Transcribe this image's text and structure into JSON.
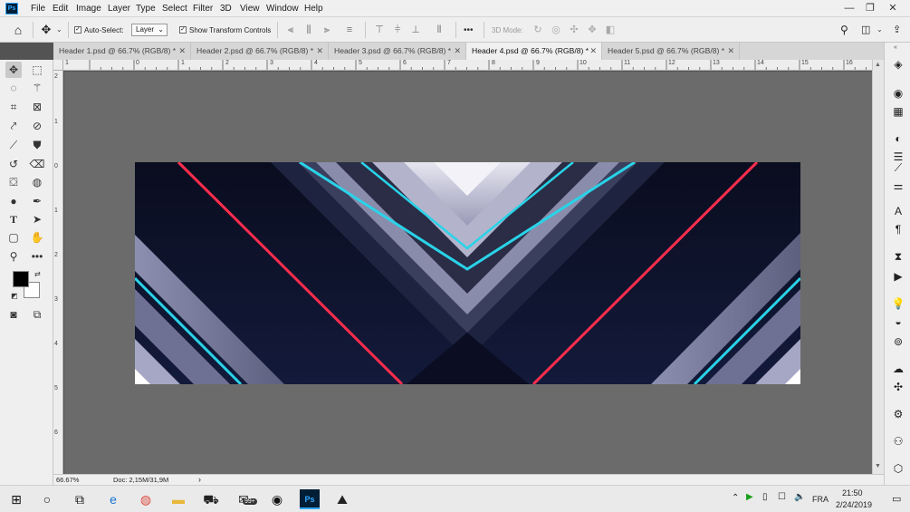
{
  "app": {
    "logo": "Ps"
  },
  "menu": [
    "File",
    "Edit",
    "Image",
    "Layer",
    "Type",
    "Select",
    "Filter",
    "3D",
    "View",
    "Window",
    "Help"
  ],
  "window_controls": {
    "minimize": "—",
    "restore": "❐",
    "close": "✕"
  },
  "options": {
    "auto_select_label": "Auto-Select:",
    "auto_select_checked": true,
    "auto_select_target": "Layer",
    "show_transform_label": "Show Transform Controls",
    "show_transform_checked": true,
    "more": "•••",
    "mode_3d_label": "3D Mode:"
  },
  "tabs": [
    {
      "label": "Header 1.psd @ 66.7% (RGB/8) *",
      "active": false
    },
    {
      "label": "Header 2.psd @ 66.7% (RGB/8) *",
      "active": false
    },
    {
      "label": "Header 3.psd @ 66.7% (RGB/8) *",
      "active": false
    },
    {
      "label": "Header 4.psd @ 66.7% (RGB/8) *",
      "active": true
    },
    {
      "label": "Header 5.psd @ 66.7% (RGB/8) *",
      "active": false
    }
  ],
  "ruler": {
    "h_labels": [
      "0",
      "1",
      "2",
      "3",
      "4",
      "5",
      "6",
      "7",
      "8",
      "9",
      "10",
      "11",
      "12",
      "13",
      "14",
      "15",
      "16"
    ],
    "v_labels": [
      "2",
      "1",
      "0",
      "1",
      "2",
      "3",
      "4",
      "5",
      "6"
    ]
  },
  "status": {
    "zoom": "66.67%",
    "doc": "Doc: 2,15M/31,9M",
    "arrow": "›"
  },
  "taskbar": {
    "badge": "99+",
    "language": "FRA",
    "time": "21:50",
    "date": "2/24/2019"
  },
  "colors": {
    "accent_red": "#ff2d4d",
    "accent_cyan": "#29d3e8",
    "canvas_bg": "#6b6b6b",
    "art_dark": "#0c1026"
  }
}
